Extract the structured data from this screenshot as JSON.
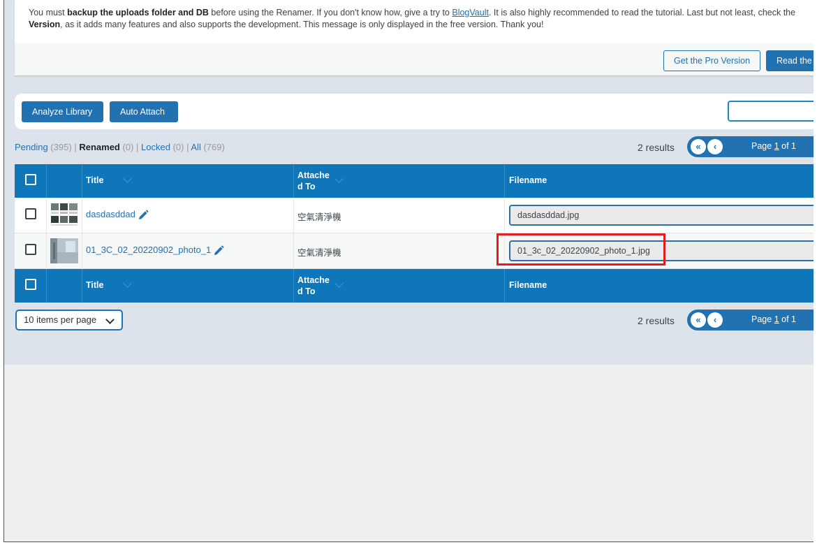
{
  "notice": {
    "line1_pre": "You must ",
    "line1_bold": "backup the uploads folder and DB",
    "line1_mid": " before using the Renamer. If you don't know how, give a try to ",
    "link_blogvault": "BlogVault",
    "line1_post": ". It is also highly recommended to read the tutorial. Last but not least, check the",
    "line2_bold": "Version",
    "line2_post": ", as it adds many features and also supports the development. This message is only displayed in the free version. Thank you!",
    "btn_get_pro": "Get the Pro Version",
    "btn_read": "Read the"
  },
  "toolbar": {
    "analyze_label": "Analyze Library",
    "auto_attach_label": "Auto Attach"
  },
  "filters": {
    "pending_label": "Pending",
    "pending_count": "(395)",
    "renamed_label": "Renamed",
    "renamed_count": "(0)",
    "locked_label": "Locked",
    "locked_count": "(0)",
    "all_label": "All",
    "all_count": "(769)",
    "sep": "|"
  },
  "pagination": {
    "results": "2 results",
    "first_icon": "«",
    "prev_icon": "‹",
    "page_word": "Page",
    "page_num": "1",
    "of_text": "of 1"
  },
  "table": {
    "headers": {
      "title": "Title",
      "attached_line1": "Attache",
      "attached_line2": "d To",
      "filename": "Filename"
    },
    "rows": [
      {
        "title": "dasdasddad",
        "attached": "空氣清淨機",
        "filename": "dasdasddad.jpg"
      },
      {
        "title": "01_3C_02_20220902_photo_1",
        "attached": "空氣清淨機",
        "filename": "01_3c_02_20220902_photo_1.jpg"
      }
    ]
  },
  "per_page": {
    "selected": "10 items per page"
  },
  "colors": {
    "accent": "#2271b1",
    "header_bg": "#0f76b9",
    "highlight": "#e11d1d"
  }
}
